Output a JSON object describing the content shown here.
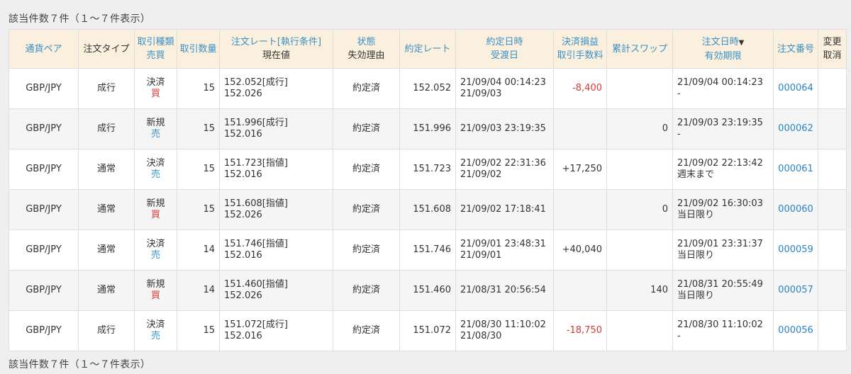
{
  "summary_top": "該当件数７件（１～７件表示）",
  "summary_bottom": "該当件数７件（１～７件表示）",
  "header": {
    "pair": "通貨ペア",
    "order_type": "注文タイプ",
    "trade_kind_1": "取引種類",
    "trade_kind_2": "売買",
    "qty": "取引数量",
    "order_rate_1": "注文レート[執行条件]",
    "order_rate_2": "現在値",
    "status_1": "状態",
    "status_2": "失効理由",
    "exec_rate": "約定レート",
    "exec_date_1": "約定日時",
    "exec_date_2": "受渡日",
    "pl_1": "決済損益",
    "pl_2": "取引手数料",
    "swap": "累計スワップ",
    "order_date_1": "注文日時",
    "sort_mark": "▼",
    "order_date_2": "有効期限",
    "order_no": "注文番号",
    "change_1": "変更",
    "change_2": "取消"
  },
  "rows": [
    {
      "pair": "GBP/JPY",
      "type": "成行",
      "kind": "決済",
      "side": "買",
      "side_class": "buy",
      "qty": "15",
      "rate": "152.052[成行]",
      "current": "152.026",
      "status": "約定済",
      "exec_rate": "152.052",
      "exec_time": "21/09/04 00:14:23",
      "settle": "21/09/03",
      "pl": "-8,400",
      "pl_class": "loss",
      "swap": "",
      "order_time": "21/09/04 00:14:23",
      "expiry": "-",
      "no": "000064"
    },
    {
      "pair": "GBP/JPY",
      "type": "成行",
      "kind": "新規",
      "side": "売",
      "side_class": "sell",
      "qty": "15",
      "rate": "151.996[成行]",
      "current": "152.016",
      "status": "約定済",
      "exec_rate": "151.996",
      "exec_time": "21/09/03 23:19:35",
      "settle": "",
      "pl": "",
      "pl_class": "",
      "swap": "0",
      "order_time": "21/09/03 23:19:35",
      "expiry": "-",
      "no": "000062"
    },
    {
      "pair": "GBP/JPY",
      "type": "通常",
      "kind": "決済",
      "side": "売",
      "side_class": "sell",
      "qty": "15",
      "rate": "151.723[指値]",
      "current": "152.016",
      "status": "約定済",
      "exec_rate": "151.723",
      "exec_time": "21/09/02 22:31:36",
      "settle": "21/09/02",
      "pl": "+17,250",
      "pl_class": "",
      "swap": "",
      "order_time": "21/09/02 22:13:42",
      "expiry": "週末まで",
      "no": "000061"
    },
    {
      "pair": "GBP/JPY",
      "type": "通常",
      "kind": "新規",
      "side": "買",
      "side_class": "buy",
      "qty": "15",
      "rate": "151.608[指値]",
      "current": "152.026",
      "status": "約定済",
      "exec_rate": "151.608",
      "exec_time": "21/09/02 17:18:41",
      "settle": "",
      "pl": "",
      "pl_class": "",
      "swap": "0",
      "order_time": "21/09/02 16:30:03",
      "expiry": "当日限り",
      "no": "000060"
    },
    {
      "pair": "GBP/JPY",
      "type": "通常",
      "kind": "決済",
      "side": "売",
      "side_class": "sell",
      "qty": "14",
      "rate": "151.746[指値]",
      "current": "152.016",
      "status": "約定済",
      "exec_rate": "151.746",
      "exec_time": "21/09/01 23:48:31",
      "settle": "21/09/01",
      "pl": "+40,040",
      "pl_class": "",
      "swap": "",
      "order_time": "21/09/01 23:31:37",
      "expiry": "当日限り",
      "no": "000059"
    },
    {
      "pair": "GBP/JPY",
      "type": "通常",
      "kind": "新規",
      "side": "買",
      "side_class": "buy",
      "qty": "14",
      "rate": "151.460[指値]",
      "current": "152.026",
      "status": "約定済",
      "exec_rate": "151.460",
      "exec_time": "21/08/31 20:56:54",
      "settle": "",
      "pl": "",
      "pl_class": "",
      "swap": "140",
      "order_time": "21/08/31 20:55:49",
      "expiry": "当日限り",
      "no": "000057"
    },
    {
      "pair": "GBP/JPY",
      "type": "成行",
      "kind": "決済",
      "side": "売",
      "side_class": "sell",
      "qty": "15",
      "rate": "151.072[成行]",
      "current": "152.016",
      "status": "約定済",
      "exec_rate": "151.072",
      "exec_time": "21/08/30 11:10:02",
      "settle": "21/08/30",
      "pl": "-18,750",
      "pl_class": "loss",
      "swap": "",
      "order_time": "21/08/30 11:10:02",
      "expiry": "-",
      "no": "000056"
    }
  ]
}
